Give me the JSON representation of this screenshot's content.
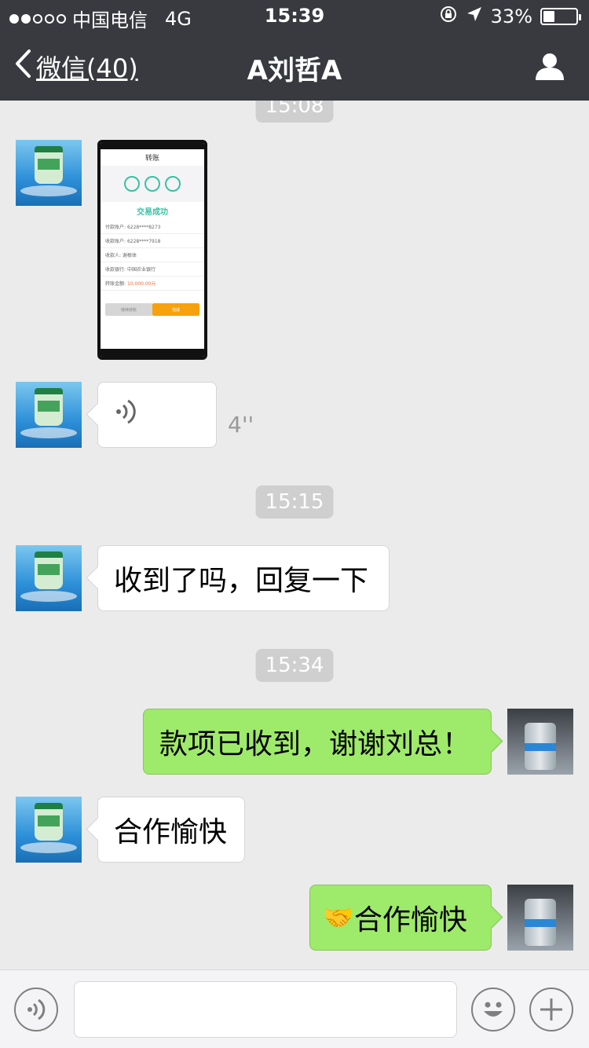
{
  "status": {
    "carrier": "中国电信",
    "network": "4G",
    "time": "15:39",
    "battery": "33%",
    "battery_level": 0.33
  },
  "nav": {
    "back_label": "微信(40)",
    "title": "A刘哲A"
  },
  "messages": {
    "ts_top": "15:08",
    "screenshot": {
      "header": "转账",
      "success": "交易成功",
      "rows": [
        {
          "label": "付款账户:",
          "value": "6228****8273"
        },
        {
          "label": "收款账户:",
          "value": "6228****7918"
        },
        {
          "label": "收款人:",
          "value": "谢根体"
        },
        {
          "label": "收款银行:",
          "value": "中国农业银行"
        },
        {
          "label": "转账金额:",
          "value": "10,000.00元"
        }
      ],
      "btn_left": "继续转账",
      "btn_right": "完成"
    },
    "voice_duration": "4''",
    "ts_1515": "15:15",
    "msg_left_1": "收到了吗，回复一下",
    "ts_1534": "15:34",
    "msg_right_1": "款项已收到，谢谢刘总！",
    "msg_left_2": "合作愉快",
    "msg_right_2": "合作愉快",
    "msg_right_2_emoji": "🤝"
  },
  "colors": {
    "nav_bg": "#393a3f",
    "chat_bg": "#ebebeb",
    "bubble_self": "#9eea6a",
    "bubble_other": "#ffffff"
  },
  "icons": [
    "back-chevron-icon",
    "profile-icon",
    "voice-icon",
    "emoji-icon",
    "plus-icon"
  ]
}
